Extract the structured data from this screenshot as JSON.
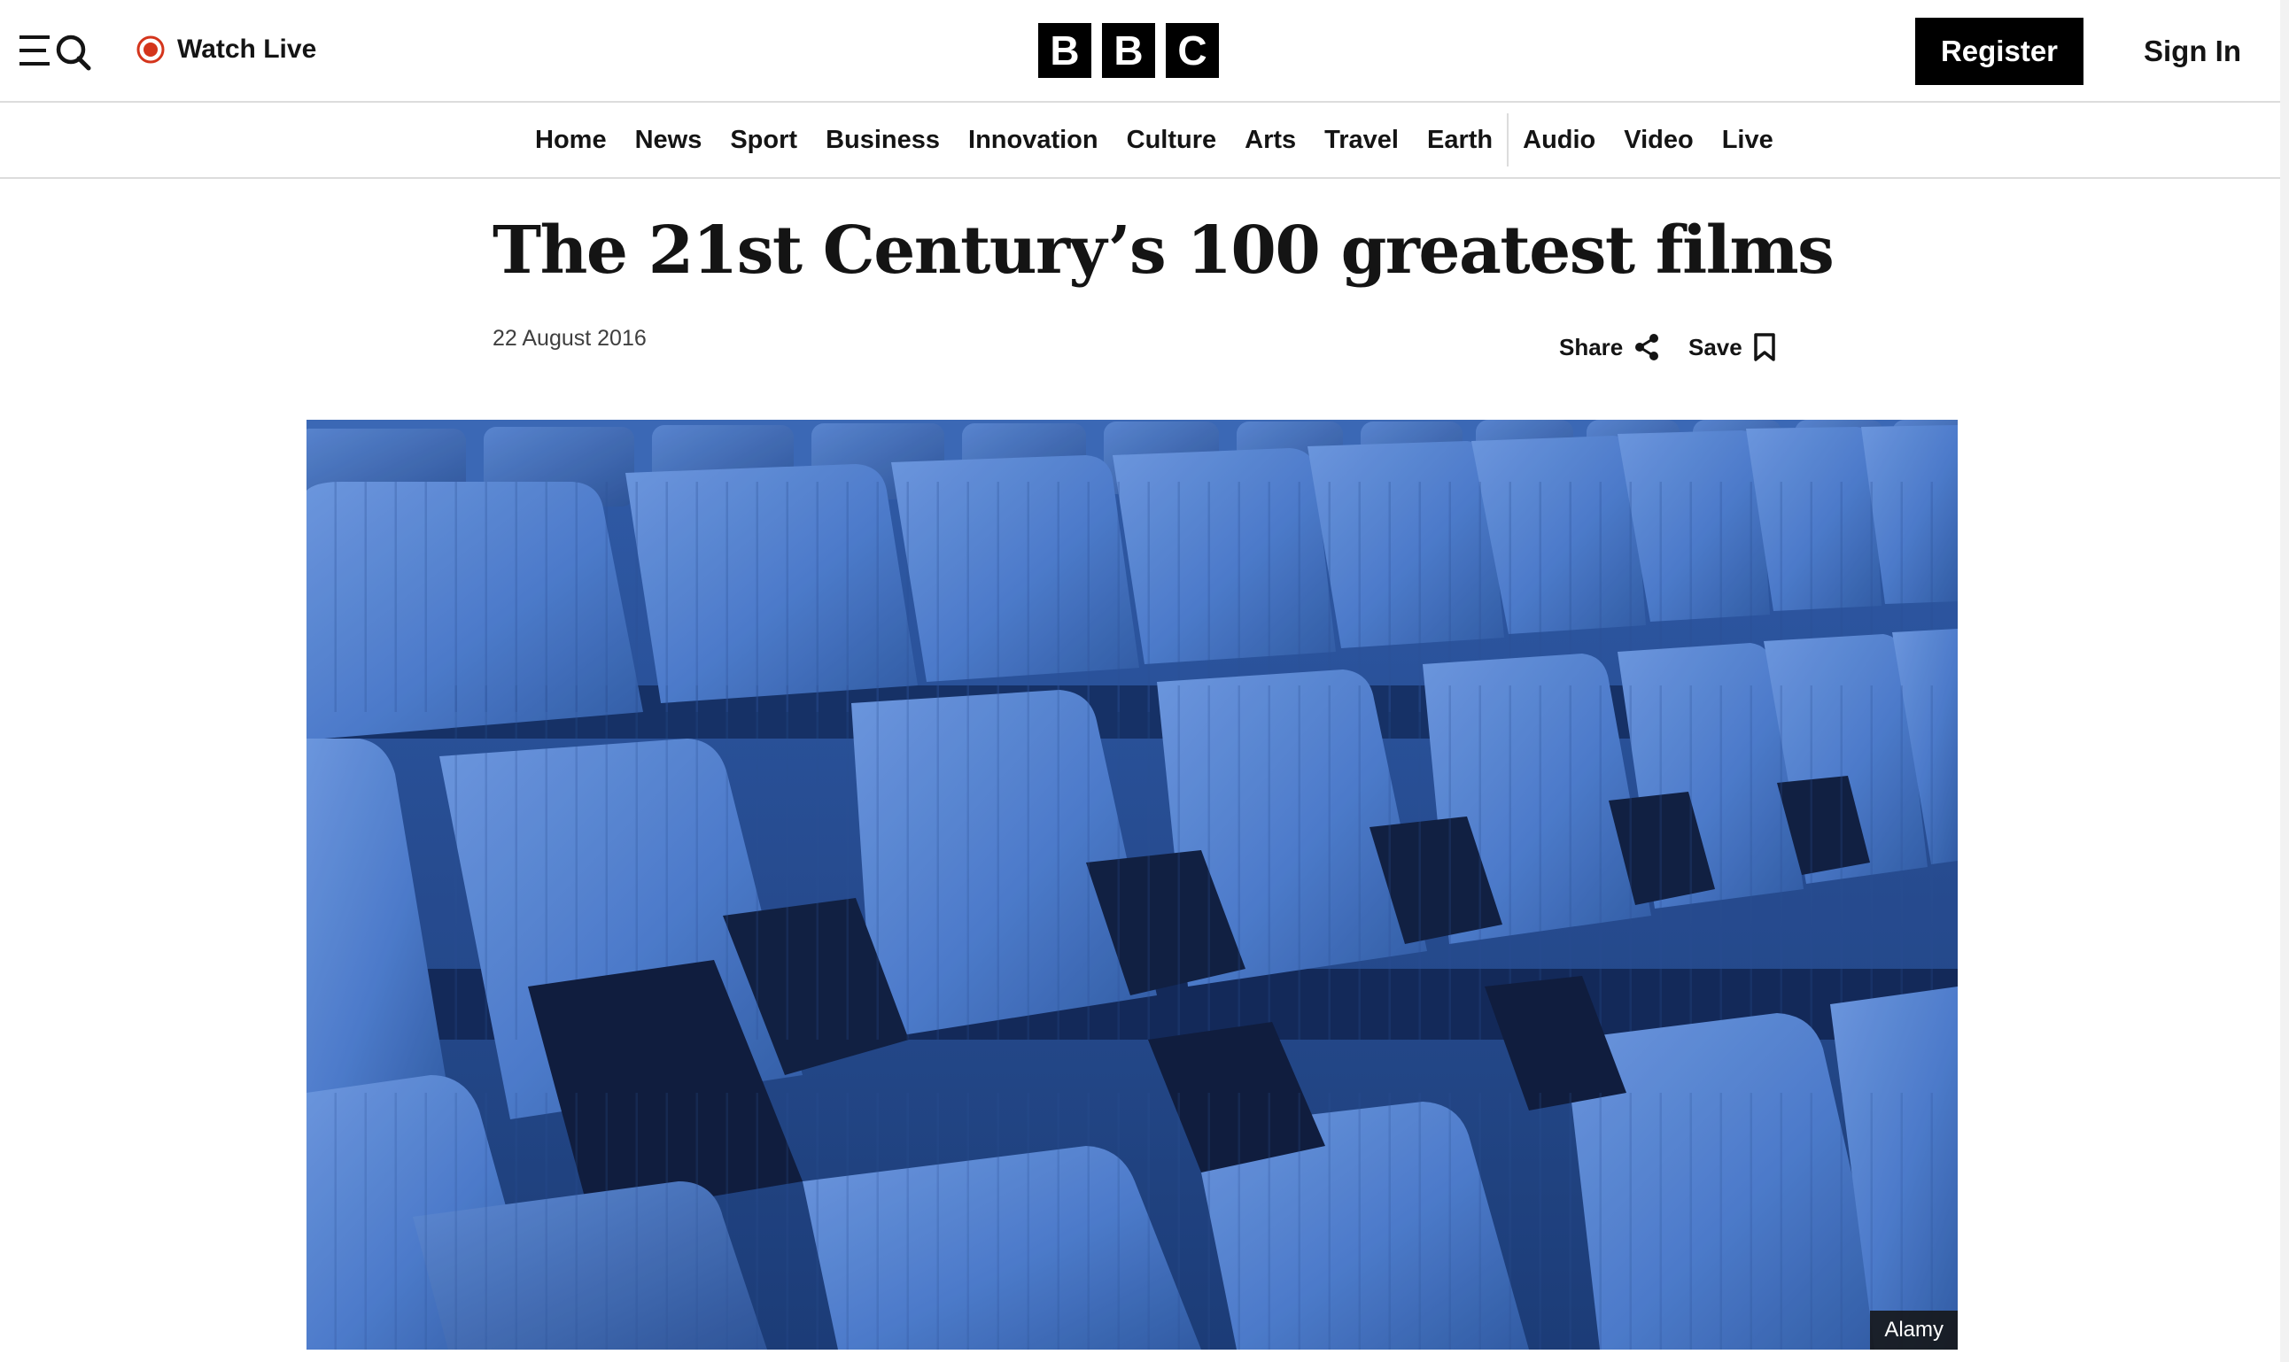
{
  "header": {
    "watch_live_label": "Watch Live",
    "logo_letters": [
      "B",
      "B",
      "C"
    ],
    "register_label": "Register",
    "signin_label": "Sign In"
  },
  "nav": {
    "items": [
      "Home",
      "News",
      "Sport",
      "Business",
      "Innovation",
      "Culture",
      "Arts",
      "Travel",
      "Earth",
      "Audio",
      "Video",
      "Live"
    ]
  },
  "article": {
    "title": "The 21st Century’s 100 greatest films",
    "date": "22 August 2016",
    "share_label": "Share",
    "save_label": "Save",
    "image_credit": "Alamy"
  },
  "colors": {
    "accent": "#000000",
    "live_red": "#d4351c",
    "seat_blue": "#3d6cc0"
  },
  "icons": {
    "menu": "menu-icon",
    "search": "search-icon",
    "live": "live-record-icon",
    "share": "share-icon",
    "save": "bookmark-icon"
  }
}
